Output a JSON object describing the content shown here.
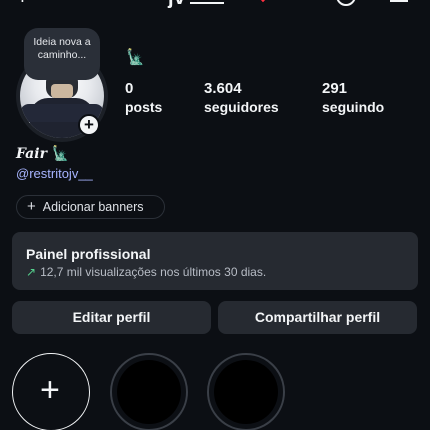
{
  "header": {
    "username": "jv"
  },
  "profile": {
    "note": "Ideia nova a caminho...",
    "statue_emoji": "🗽",
    "display_name": "Fair",
    "handle": "@restritojv__"
  },
  "stats": [
    {
      "value": "0",
      "label": "posts"
    },
    {
      "value": "3.604",
      "label": "seguidores"
    },
    {
      "value": "291",
      "label": "seguindo"
    }
  ],
  "banners": {
    "label": "Adicionar banners"
  },
  "professional_panel": {
    "title": "Painel profissional",
    "subtitle": "12,7 mil visualizações nos últimos 30 dias."
  },
  "actions": {
    "edit_label": "Editar perfil",
    "share_label": "Compartilhar perfil"
  },
  "colors": {
    "background": "#0c0f14",
    "card": "#262a31",
    "handle": "#a7b4ff",
    "trend_green": "#55d08d",
    "notification_red": "#ff3040"
  },
  "icons": {
    "new_post": "plus-icon",
    "account_switch": "chevron-down-icon",
    "threads": "threads-icon",
    "menu": "hamburger-menu-icon",
    "avatar_add": "add-story-icon",
    "banner_add": "plus-icon",
    "trend": "trend-up-arrow-icon",
    "new_highlight": "plus-icon"
  }
}
